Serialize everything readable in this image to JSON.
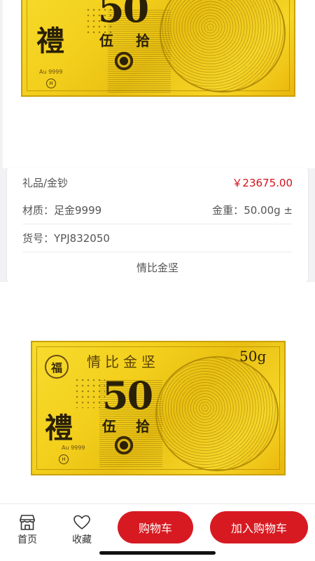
{
  "product": {
    "category": "礼品/金钞",
    "price": "￥23675.00",
    "material_label": "材质：",
    "material_value": "足金9999",
    "weight_label": "金重：",
    "weight_value": "50.00g ±",
    "sku_label": "货号：",
    "sku_value": "YPJ832050",
    "name": "情比金坚"
  },
  "note": {
    "denomination": "50",
    "big_char": "禮",
    "wu": "伍",
    "shi": "拾",
    "title": "情比金坚",
    "weight_mark": "50g",
    "fu": "福",
    "purity": "Au 9999"
  },
  "bottom_bar": {
    "home_label": "首页",
    "favorite_label": "收藏",
    "cart_label": "购物车",
    "add_cart_label": "加入购物车"
  },
  "colors": {
    "accent": "#d71a21",
    "price": "#d4111b",
    "gold": "#f3cf1c"
  }
}
